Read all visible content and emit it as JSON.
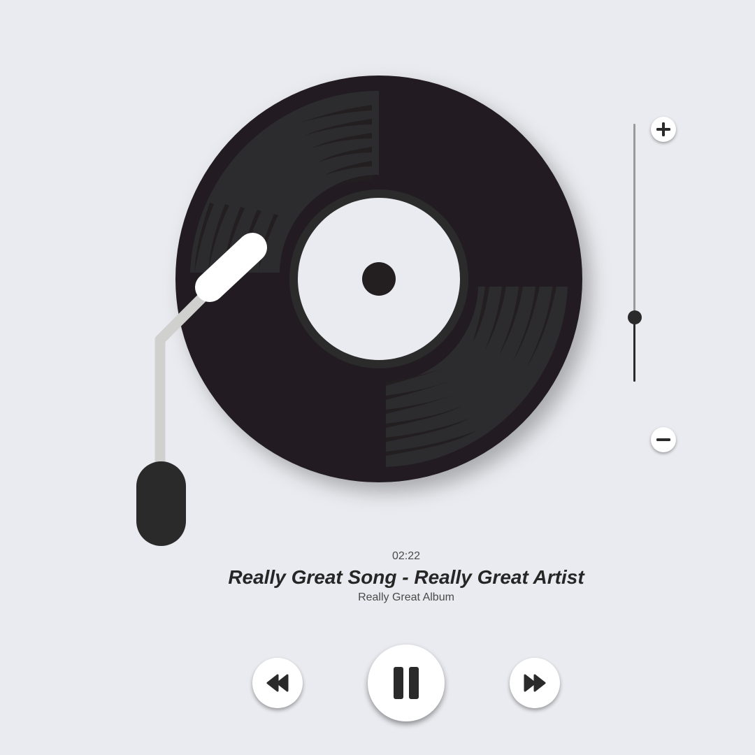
{
  "player": {
    "time": "02:22",
    "title": "Really Great Song - Really Great Artist",
    "album": "Really Great Album",
    "state": "playing"
  },
  "volume": {
    "level": 0.25,
    "up_icon": "plus-icon",
    "down_icon": "minus-icon"
  },
  "controls": {
    "prev_icon": "rewind-icon",
    "pause_icon": "pause-icon",
    "next_icon": "fast-forward-icon"
  },
  "colors": {
    "background": "#eaebf0",
    "record": "#231f20",
    "groove_highlight": "#2e2e2f",
    "label": "#eaebf0",
    "tonearm": "#d0d0cf",
    "accent_dark": "#2a2a2a"
  }
}
